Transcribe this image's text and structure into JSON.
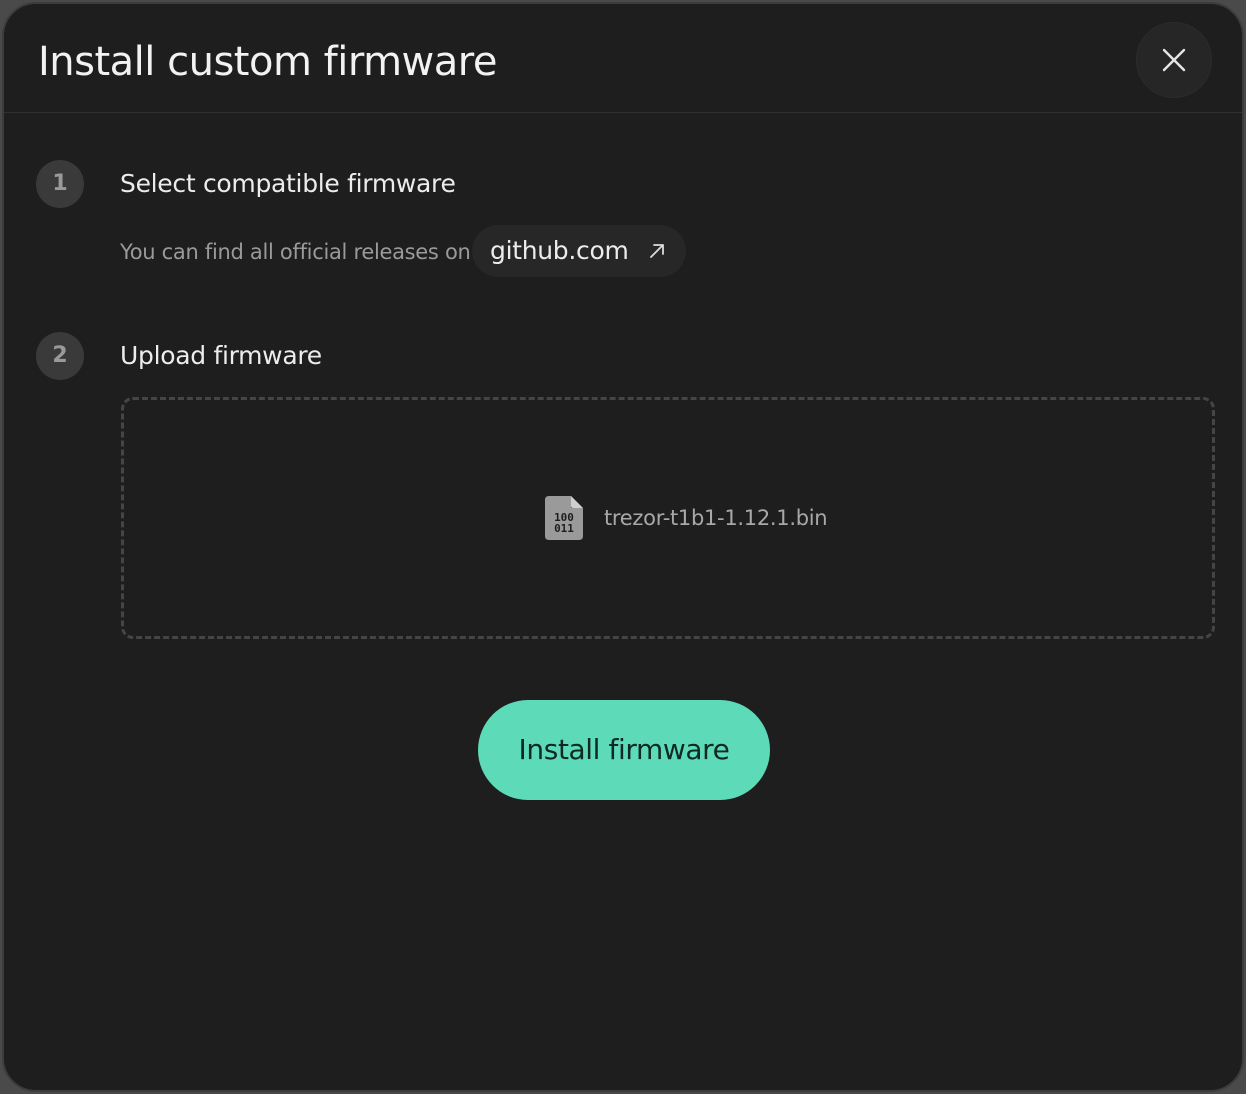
{
  "dialog": {
    "title": "Install custom firmware",
    "close_icon": "close-icon"
  },
  "steps": [
    {
      "number": "1",
      "title": "Select compatible firmware",
      "hint": "You can find all official releases on",
      "link_label": "github.com",
      "link_icon": "external-link-arrow-icon"
    },
    {
      "number": "2",
      "title": "Upload firmware",
      "file_icon": "binary-file-icon",
      "file_name": "trezor-t1b1-1.12.1.bin"
    }
  ],
  "actions": {
    "install_label": "Install firmware"
  },
  "colors": {
    "background": "#1e1e1e",
    "accent": "#5ddbb9",
    "step_badge": "#3a3a3a"
  }
}
